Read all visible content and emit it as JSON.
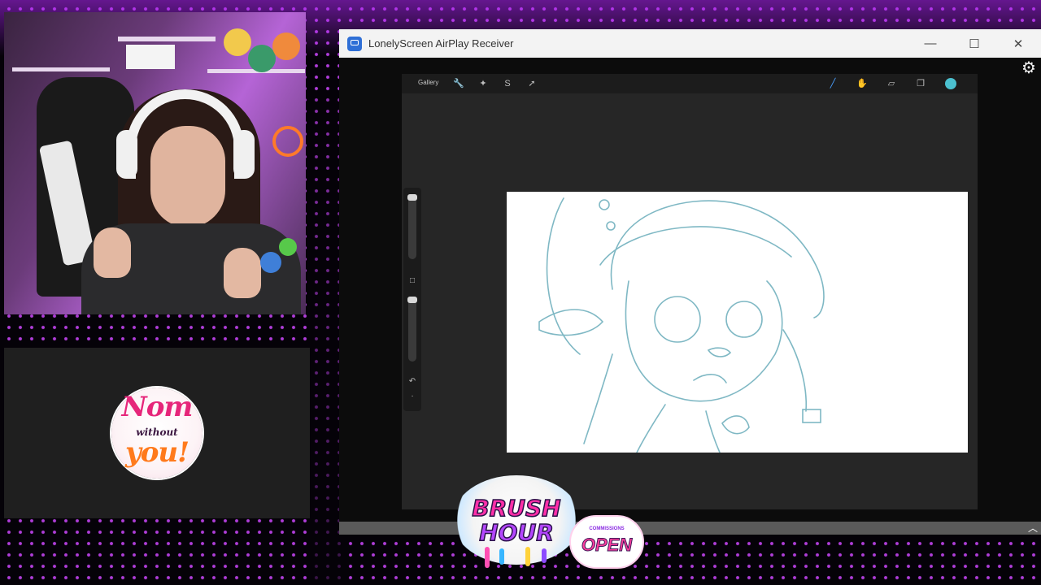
{
  "window": {
    "title": "LonelyScreen AirPlay Receiver",
    "minimize_icon": "minimize-icon",
    "maximize_icon": "maximize-icon",
    "close_icon": "close-icon",
    "minimize_glyph": "—",
    "maximize_glyph": "☐",
    "close_glyph": "✕",
    "settings_glyph": "⚙",
    "scroll_up_glyph": "︿"
  },
  "procreate": {
    "gallery_label": "Gallery",
    "toolbar_glyphs": {
      "wrench": "🔧",
      "wand": "✦",
      "selection": "S",
      "transform": "➚",
      "brush": "╱",
      "smudge": "✋",
      "eraser": "▱",
      "layers": "❐"
    },
    "sidebar_glyphs": {
      "modify": "□",
      "undo": "↶",
      "redo": "·"
    },
    "active_color": "#4bc0cf"
  },
  "overlay": {
    "logo": {
      "line1": "Nom",
      "line2": "without",
      "line3": "you!"
    },
    "sticker": {
      "brush": "BRUSH",
      "hour": "HOUR",
      "commissions": "COMMISSIONS",
      "open": "OPEN"
    }
  },
  "colors": {
    "led_purple": "#ce48ff",
    "canvas_line": "#7fb8c4",
    "titlebar": "#f3f3f3"
  }
}
